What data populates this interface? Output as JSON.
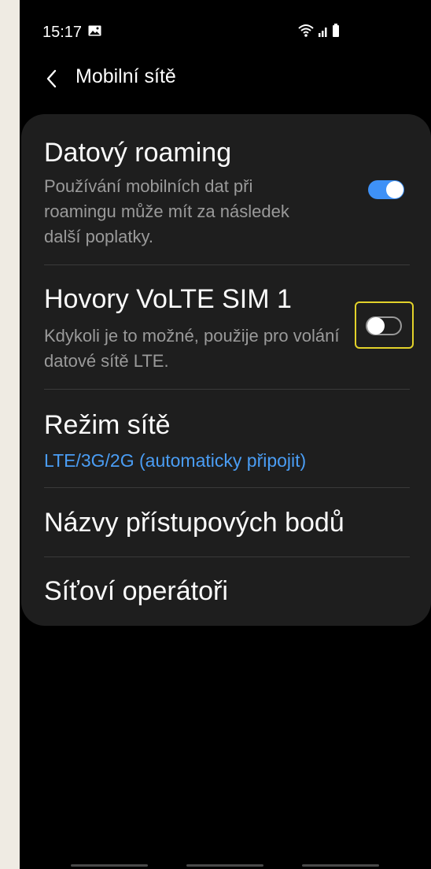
{
  "status_bar": {
    "time": "15:17",
    "left_icon": "photo-icon",
    "right_icons": [
      "wifi-icon",
      "signal-icon",
      "battery-icon"
    ]
  },
  "app_bar": {
    "back_icon": "back-arrow-icon",
    "title": "Mobilní sítě"
  },
  "settings": {
    "data_roaming": {
      "title": "Datový roaming",
      "subtitle": "Používání mobilních dat při roamingu může mít za následek další poplatky.",
      "enabled": true
    },
    "volte": {
      "title": "Hovory VoLTE SIM 1",
      "subtitle": "Kdykoli je to možné, použije pro volání datové sítě LTE.",
      "enabled": false
    },
    "network_mode": {
      "title": "Režim sítě",
      "value": "LTE/3G/2G (automaticky připojit)"
    },
    "apn": {
      "title": "Názvy přístupových bodů"
    },
    "operators": {
      "title": "Síťoví operátoři"
    }
  },
  "colors": {
    "accent": "#3e91f7",
    "link": "#4a9df4",
    "card": "#1e1e1e",
    "highlight": "#e2d22a"
  }
}
